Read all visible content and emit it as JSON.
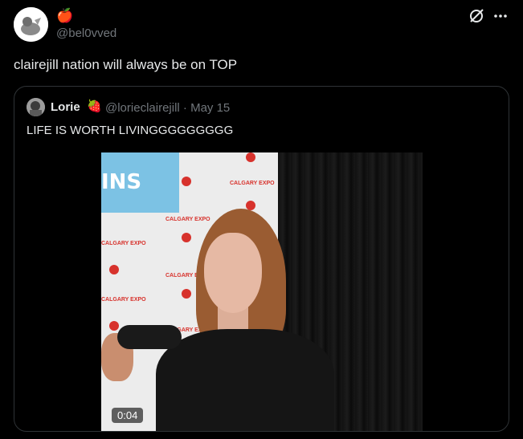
{
  "author": {
    "apple_emoji": "🍎",
    "handle": "@bel0vved"
  },
  "tweet": {
    "text": "clairejill nation will always be on TOP"
  },
  "quoted": {
    "name": "Lorie",
    "emoji": "🍓",
    "handle_date": "@lorieclairejill · May 15",
    "text": "LIFE IS WORTH LIVINGGGGGGGGG",
    "video": {
      "timestamp": "0:04",
      "banner_text": "INS",
      "sponsor": "CALGARY EXPO"
    }
  },
  "icons": {
    "grok": "grok-icon",
    "more": "more-icon"
  },
  "colors": {
    "background": "#000000",
    "text": "#e7e9ea",
    "muted": "#71767b",
    "border": "#2f3336"
  }
}
